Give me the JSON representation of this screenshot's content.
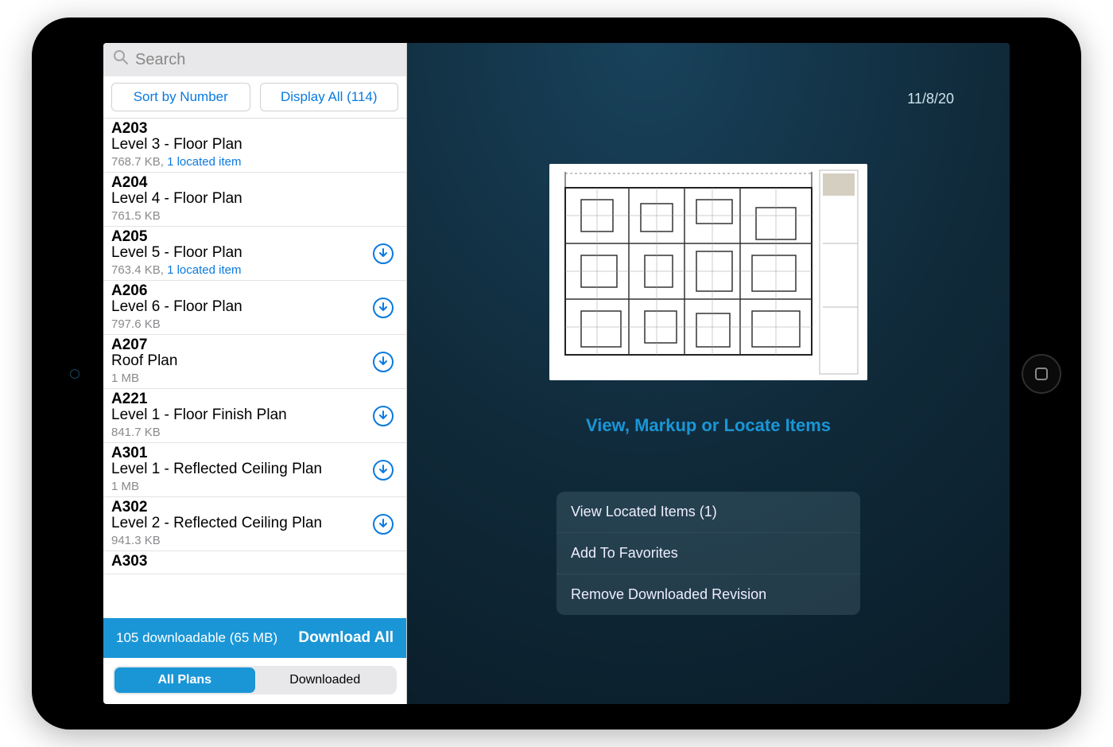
{
  "search": {
    "placeholder": "Search"
  },
  "filters": {
    "sort": "Sort by Number",
    "display": "Display All (114)"
  },
  "plans": [
    {
      "num": "A203",
      "title": "Level 3 - Floor Plan",
      "size": "768.7 KB",
      "located": "1 located item",
      "download_icon": false
    },
    {
      "num": "A204",
      "title": "Level 4 - Floor Plan",
      "size": "761.5 KB",
      "located": "",
      "download_icon": false
    },
    {
      "num": "A205",
      "title": "Level 5 - Floor Plan",
      "size": "763.4 KB",
      "located": "1 located item",
      "download_icon": true
    },
    {
      "num": "A206",
      "title": "Level 6 - Floor Plan",
      "size": "797.6 KB",
      "located": "",
      "download_icon": true
    },
    {
      "num": "A207",
      "title": "Roof Plan",
      "size": "1 MB",
      "located": "",
      "download_icon": true
    },
    {
      "num": "A221",
      "title": "Level 1 - Floor Finish Plan",
      "size": "841.7 KB",
      "located": "",
      "download_icon": true
    },
    {
      "num": "A301",
      "title": "Level 1 - Reflected Ceiling Plan",
      "size": "1 MB",
      "located": "",
      "download_icon": true
    },
    {
      "num": "A302",
      "title": "Level 2 - Reflected Ceiling Plan",
      "size": "941.3 KB",
      "located": "",
      "download_icon": true
    },
    {
      "num": "A303",
      "title": "",
      "size": "",
      "located": "",
      "download_icon": false
    }
  ],
  "download_bar": {
    "status": "105 downloadable (65 MB)",
    "action": "Download All"
  },
  "tabs": {
    "all": "All Plans",
    "downloaded": "Downloaded"
  },
  "detail": {
    "date": "11/8/20",
    "view_link": "View, Markup or Locate Items",
    "actions": [
      "View Located Items (1)",
      "Add To Favorites",
      "Remove Downloaded Revision"
    ]
  }
}
